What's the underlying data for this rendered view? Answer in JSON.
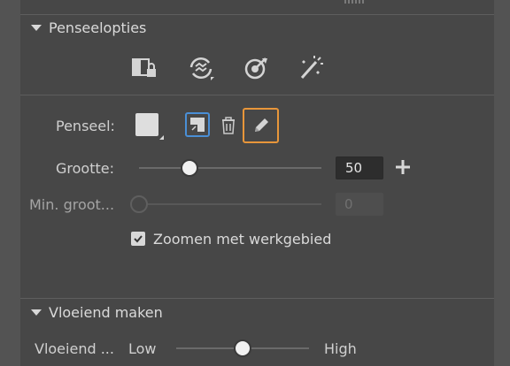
{
  "sections": {
    "brush_options": {
      "title": "Penseelopties"
    },
    "smoothing": {
      "title": "Vloeiend maken"
    }
  },
  "toolbar_icons": [
    "lock-layer-icon",
    "sync-icon",
    "target-icon",
    "magic-wand-icon"
  ],
  "brush": {
    "label": "Penseel:",
    "size_label": "Grootte:",
    "size_value": "50",
    "size_fraction": 0.25,
    "min_size_label": "Min. groot...",
    "min_size_value": "0",
    "min_size_fraction": 0.0,
    "zoom_checkbox_label": "Zoomen met werkgebied",
    "zoom_checked": true,
    "active_tool": "pencil-icon"
  },
  "smoothing": {
    "label": "Vloeiend ...",
    "low_label": "Low",
    "high_label": "High",
    "fraction": 0.5
  },
  "colors": {
    "accent_orange": "#e8963a",
    "active_blue": "#4a8fd6",
    "panel_bg": "#474747"
  }
}
